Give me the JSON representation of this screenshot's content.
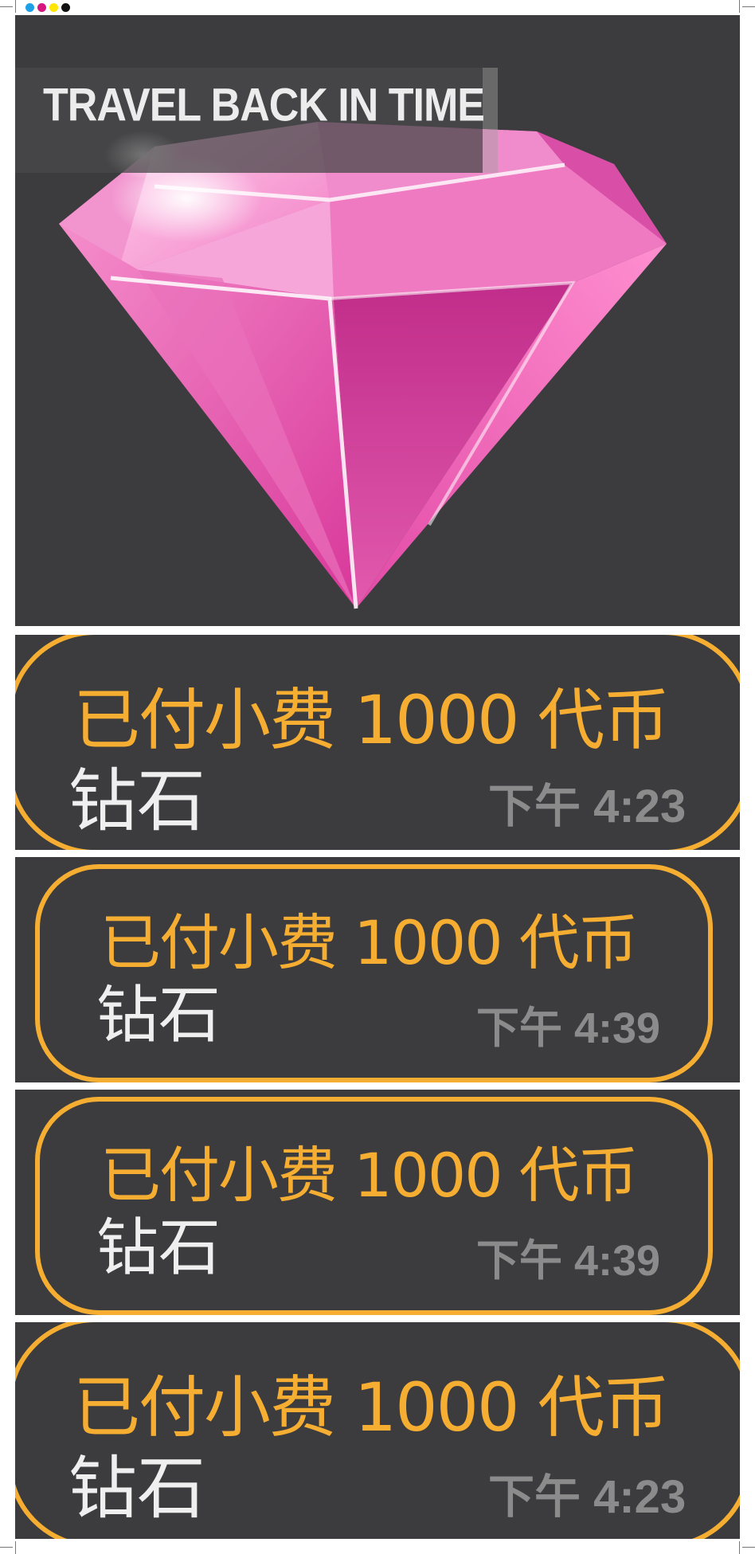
{
  "hero": {
    "banner_title": "TRAVEL BACK IN TIME",
    "image_icon": "pink-diamond-icon"
  },
  "colors": {
    "panel_bg": "#3c3c3e",
    "accent": "#f6ae32",
    "sub_text": "#efefef",
    "time_text": "#8b8b8b",
    "diamond": "#e94aa8"
  },
  "messages": [
    {
      "title": "已付小费 1000 代币",
      "item": "钻石",
      "time": "下午 4:23"
    },
    {
      "title": "已付小费 1000 代币",
      "item": "钻石",
      "time": "下午 4:39"
    },
    {
      "title": "已付小费 1000 代币",
      "item": "钻石",
      "time": "下午 4:39"
    },
    {
      "title": "已付小费 1000 代币",
      "item": "钻石",
      "time": "下午 4:23"
    }
  ]
}
